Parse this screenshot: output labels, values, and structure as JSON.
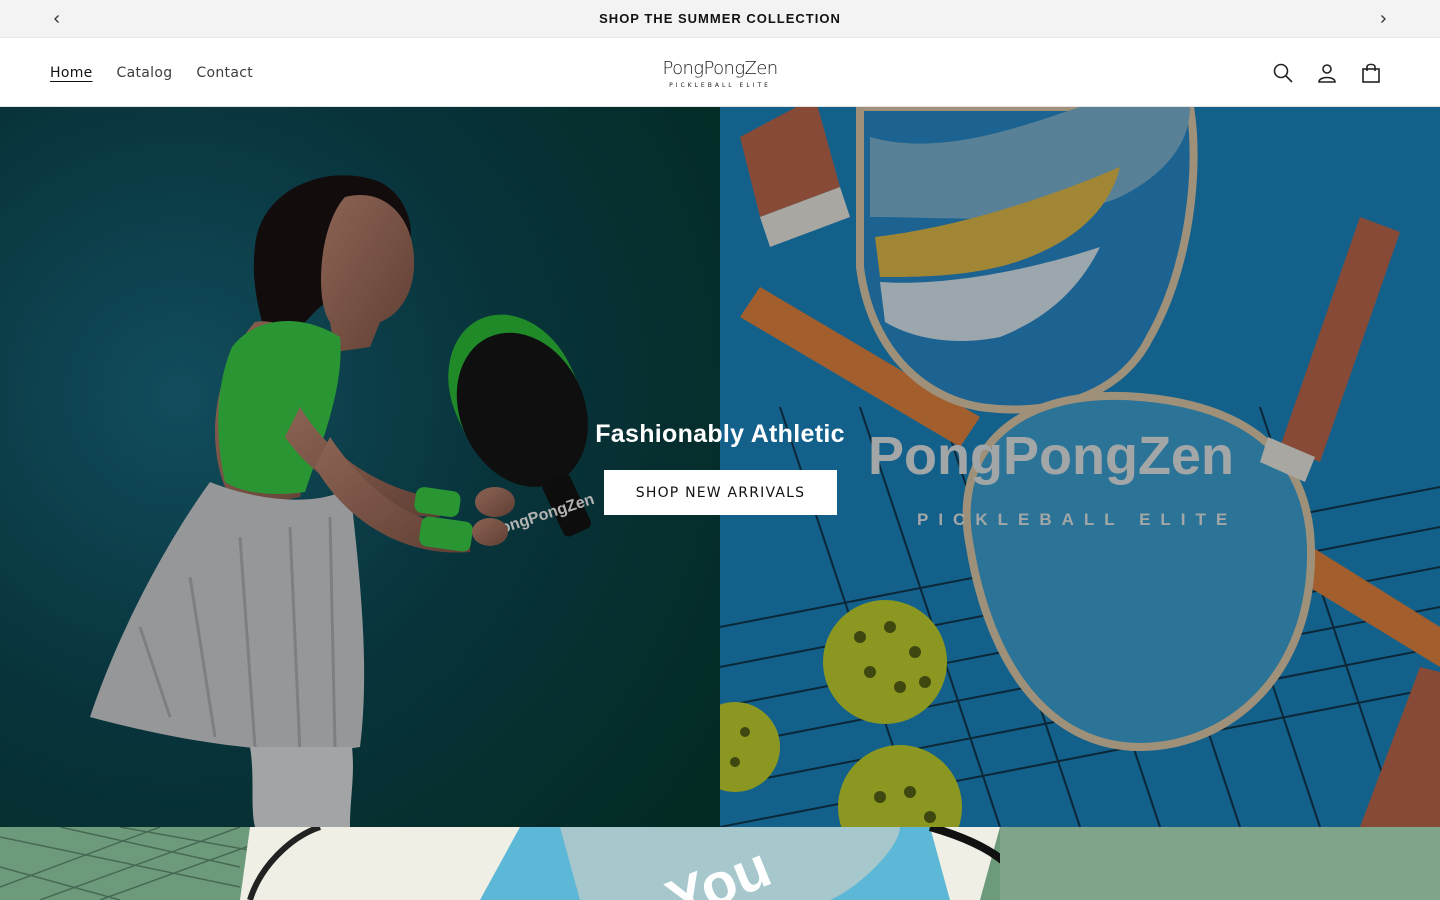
{
  "announcement": {
    "text": "SHOP THE SUMMER COLLECTION",
    "prev_icon": "chevron-left-icon",
    "next_icon": "chevron-right-icon"
  },
  "header": {
    "nav": [
      {
        "label": "Home",
        "active": true
      },
      {
        "label": "Catalog",
        "active": false
      },
      {
        "label": "Contact",
        "active": false
      }
    ],
    "logo": {
      "name": "PongPongZen",
      "tagline": "PICKLEBALL ELITE"
    },
    "icons": [
      "search-icon",
      "account-icon",
      "cart-icon"
    ]
  },
  "hero": {
    "heading": "Fashionably Athletic",
    "button_label": "SHOP NEW ARRIVALS",
    "left_image_paddle_text": "PongPongZen",
    "right_image_brand": "PongPongZen",
    "right_image_tagline": "PICKLEBALL ELITE"
  },
  "next_banner": {
    "visible_text": "You"
  },
  "colors": {
    "announcement_bg": "#f3f3f3",
    "text": "#121212",
    "hero_left_bg": "#0b3a3a",
    "hero_right_bg": "#1a7fb5",
    "accent_green": "#3dd64a",
    "ball_yellow": "#c7d92e"
  }
}
